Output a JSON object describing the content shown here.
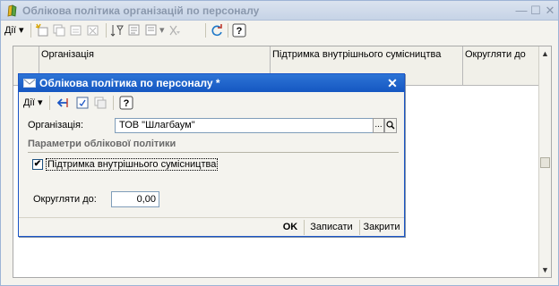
{
  "window": {
    "title": "Облікова політика організацій по персоналу",
    "controls": [
      "minimize-icon",
      "maximize-icon",
      "close-icon"
    ]
  },
  "toolbar": {
    "actions_label": "Дії",
    "dropdown_arrow": "▾",
    "icons": [
      "add-icon",
      "copy-icon",
      "edit-icon",
      "delete-icon",
      "filter-icon",
      "filter-set-icon",
      "filter-dropdown-icon",
      "filter-off-icon",
      "refresh-icon",
      "help-icon"
    ]
  },
  "table": {
    "columns": [
      "Організація",
      "Підтримка внутрішнього сумісництва",
      "Округляти до"
    ]
  },
  "dialog": {
    "title": "Облікова політика по персоналу *",
    "toolbar": {
      "actions_label": "Дії",
      "icons": [
        "back-icon",
        "save-doc-icon",
        "copy-doc-icon",
        "help-icon"
      ]
    },
    "organization_label": "Організація:",
    "organization_value": "ТОВ \"Шлагбаум\"",
    "organization_select_btn": "...",
    "organization_open_btn": "🔍",
    "section_title": "Параметри облікової політики",
    "checkbox_label": "Підтримка внутрішнього сумісництва",
    "checkbox_checked": true,
    "checkbox_mark": "✔",
    "round_label": "Округляти до:",
    "round_value": "0,00",
    "buttons": {
      "ok": "OK",
      "save": "Записати",
      "close": "Закрити"
    }
  },
  "colors": {
    "dialog_title_bg": "#1557c2",
    "outer_title_bg": "#c6d3e6"
  }
}
